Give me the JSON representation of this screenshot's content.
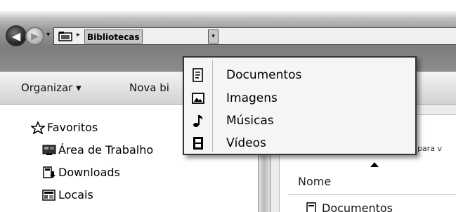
{
  "address": {
    "crumb": "Bibliotecas",
    "separator": "▸",
    "history_dropdown": "▾",
    "dropdown_button": "▾"
  },
  "nav_buttons": {
    "back": "◀",
    "forward": "▶"
  },
  "toolbar": {
    "organizar_label": "Organizar ▾",
    "nova_label": "Nova bi"
  },
  "sidebar": {
    "favoritos": "Favoritos",
    "items": [
      {
        "label": "Área de Trabalho",
        "icon": "desktop-icon"
      },
      {
        "label": "Downloads",
        "icon": "downloads-icon"
      },
      {
        "label": "Locais",
        "icon": "recent-places-icon"
      }
    ]
  },
  "menu": {
    "items": [
      {
        "label": "Documentos",
        "icon": "documents-icon"
      },
      {
        "label": "Imagens",
        "icon": "pictures-icon"
      },
      {
        "label": "Músicas",
        "icon": "music-icon"
      },
      {
        "label": "Vídeos",
        "icon": "videos-icon"
      }
    ]
  },
  "content": {
    "hint": "para v",
    "column_header": "Nome",
    "first_row": "Documentos"
  }
}
